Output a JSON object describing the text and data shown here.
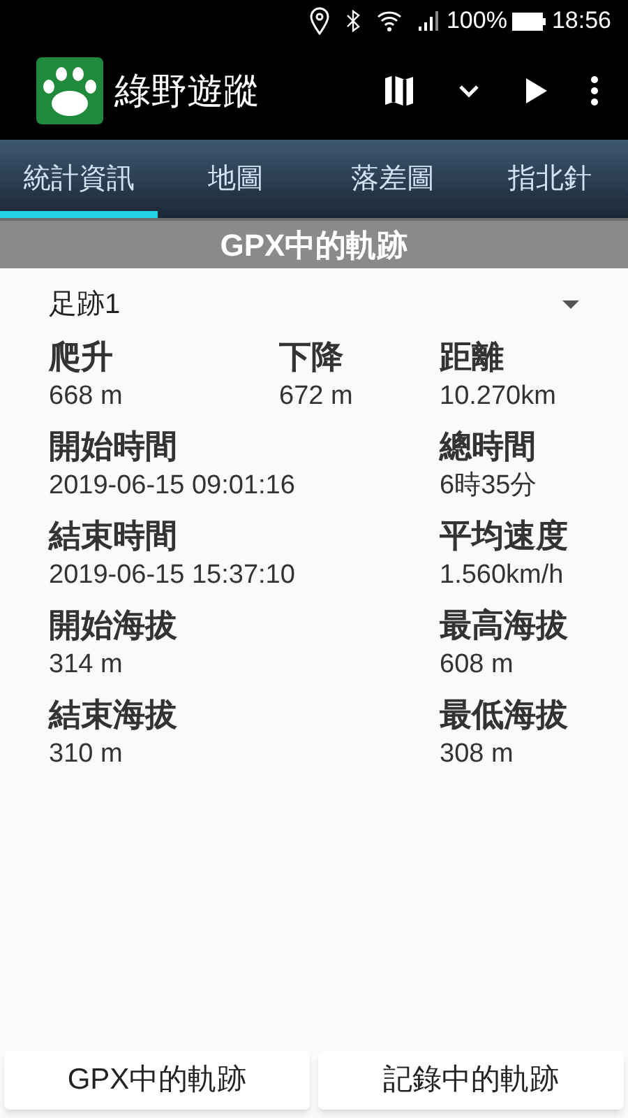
{
  "status_bar": {
    "battery": "100%",
    "time": "18:56"
  },
  "app_bar": {
    "title": "綠野遊蹤"
  },
  "tabs": [
    {
      "label": "統計資訊",
      "selected": true
    },
    {
      "label": "地圖",
      "selected": false
    },
    {
      "label": "落差圖",
      "selected": false
    },
    {
      "label": "指北針",
      "selected": false
    }
  ],
  "section_title": "GPX中的軌跡",
  "track_select": {
    "value": "足跡1"
  },
  "stats": [
    [
      {
        "label": "爬升",
        "value": "668 m"
      },
      {
        "label": "下降",
        "value": "672 m"
      },
      {
        "label": "距離",
        "value": "10.270km"
      }
    ],
    [
      {
        "label": "開始時間",
        "value": "2019-06-15 09:01:16"
      },
      {
        "label": "總時間",
        "value": "6時35分"
      }
    ],
    [
      {
        "label": "結束時間",
        "value": "2019-06-15 15:37:10"
      },
      {
        "label": "平均速度",
        "value": "1.560km/h"
      }
    ],
    [
      {
        "label": "開始海拔",
        "value": "314 m"
      },
      {
        "label": "最高海拔",
        "value": "608 m"
      }
    ],
    [
      {
        "label": "結束海拔",
        "value": "310 m"
      },
      {
        "label": "最低海拔",
        "value": "308 m"
      }
    ]
  ],
  "buttons": [
    "GPX中的軌跡",
    "記錄中的軌跡"
  ]
}
